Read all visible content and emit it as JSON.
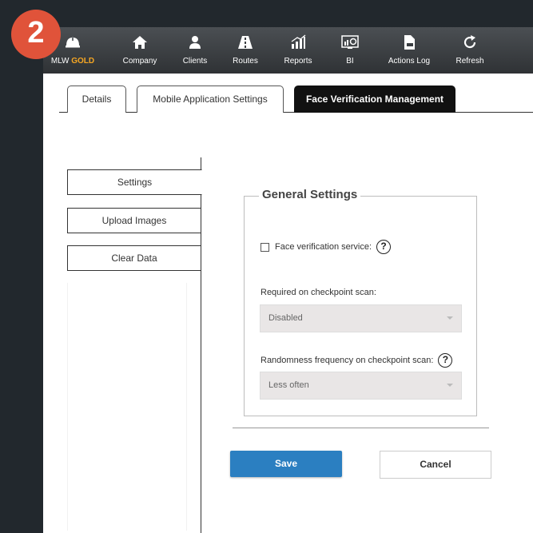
{
  "step_badge": "2",
  "navbar": {
    "brand": {
      "prefix": "MLW",
      "highlight": "GOLD",
      "icon": "helmet-icon"
    },
    "items": [
      {
        "label": "Company",
        "icon": "home-icon"
      },
      {
        "label": "Clients",
        "icon": "user-icon"
      },
      {
        "label": "Routes",
        "icon": "road-icon"
      },
      {
        "label": "Reports",
        "icon": "bar-chart-icon"
      },
      {
        "label": "BI",
        "icon": "dashboard-icon"
      },
      {
        "label": "Actions Log",
        "icon": "log-document-icon"
      },
      {
        "label": "Refresh",
        "icon": "refresh-icon"
      }
    ]
  },
  "tabs": [
    {
      "label": "Details",
      "active": false
    },
    {
      "label": "Mobile Application Settings",
      "active": false
    },
    {
      "label": "Face Verification Management",
      "active": true
    }
  ],
  "sidebar": {
    "items": [
      {
        "label": "Settings",
        "active": true
      },
      {
        "label": "Upload Images",
        "active": false
      },
      {
        "label": "Clear Data",
        "active": false
      }
    ]
  },
  "general_settings": {
    "title": "General Settings",
    "face_verification": {
      "label": "Face verification service:",
      "checked": false
    },
    "required_on_scan": {
      "label": "Required on checkpoint scan:",
      "value": "Disabled"
    },
    "randomness": {
      "label": "Randomness frequency on checkpoint scan:",
      "value": "Less often"
    },
    "help_glyph": "?"
  },
  "actions": {
    "save": "Save",
    "cancel": "Cancel"
  },
  "colors": {
    "accent": "#2b7fc1",
    "brand_highlight": "#f5a623",
    "badge": "#e0533a",
    "navbar": "#3a3e42"
  }
}
